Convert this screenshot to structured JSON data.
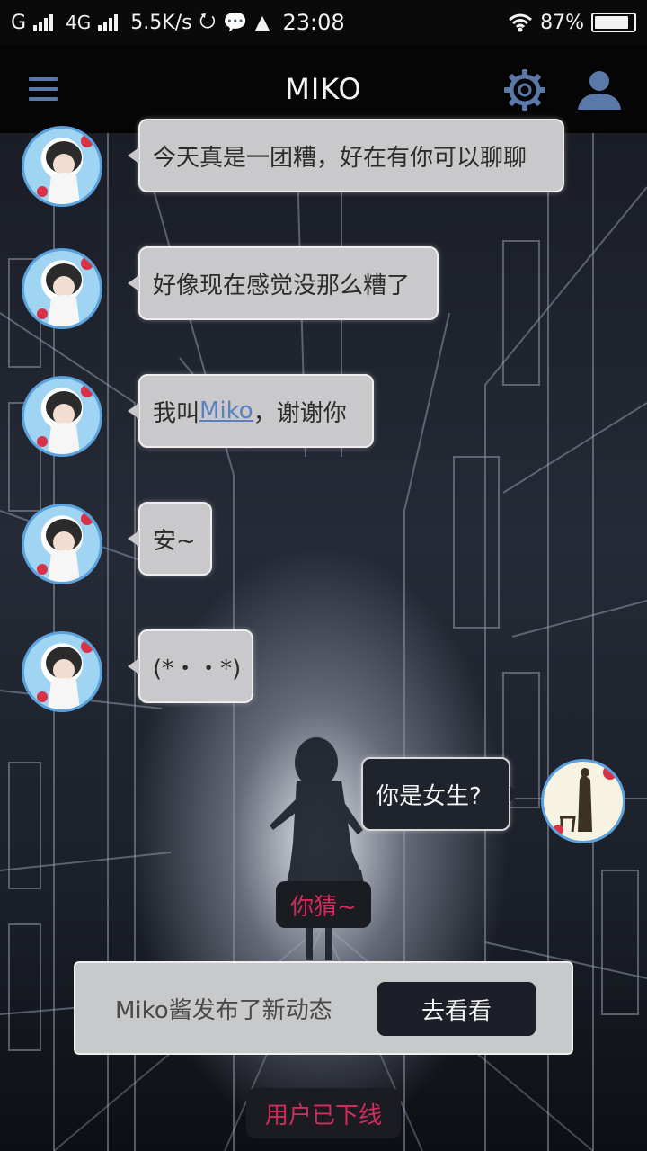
{
  "status_bar": {
    "carrier": "G",
    "network": "4G",
    "speed": "5.5K/s",
    "time": "23:08",
    "battery": "87%",
    "battery_level": 0.87
  },
  "header": {
    "title": "MIKO",
    "icons": [
      "menu-icon",
      "gear-icon",
      "user-icon"
    ],
    "accent_color": "#5b79a8"
  },
  "messages": [
    {
      "side": "left",
      "text": "今天真是一团糟，好在有你可以聊聊"
    },
    {
      "side": "left",
      "text": "好像现在感觉没那么糟了"
    },
    {
      "side": "left",
      "text_before": "我叫",
      "link": "Miko",
      "text_after": "，谢谢你"
    },
    {
      "side": "left",
      "text": "安~"
    },
    {
      "side": "left",
      "text": "(*・・*)"
    },
    {
      "side": "right",
      "text": "你是女生?"
    }
  ],
  "hint": "你猜~",
  "notice": {
    "text": "Miko酱发布了新动态",
    "button": "去看看"
  },
  "offline_status": "用户已下线",
  "colors": {
    "bubble_left": "#c9c9cb",
    "bubble_right": "#1f232c",
    "alert_text": "#d12c5c",
    "link": "#5b7fc0"
  }
}
